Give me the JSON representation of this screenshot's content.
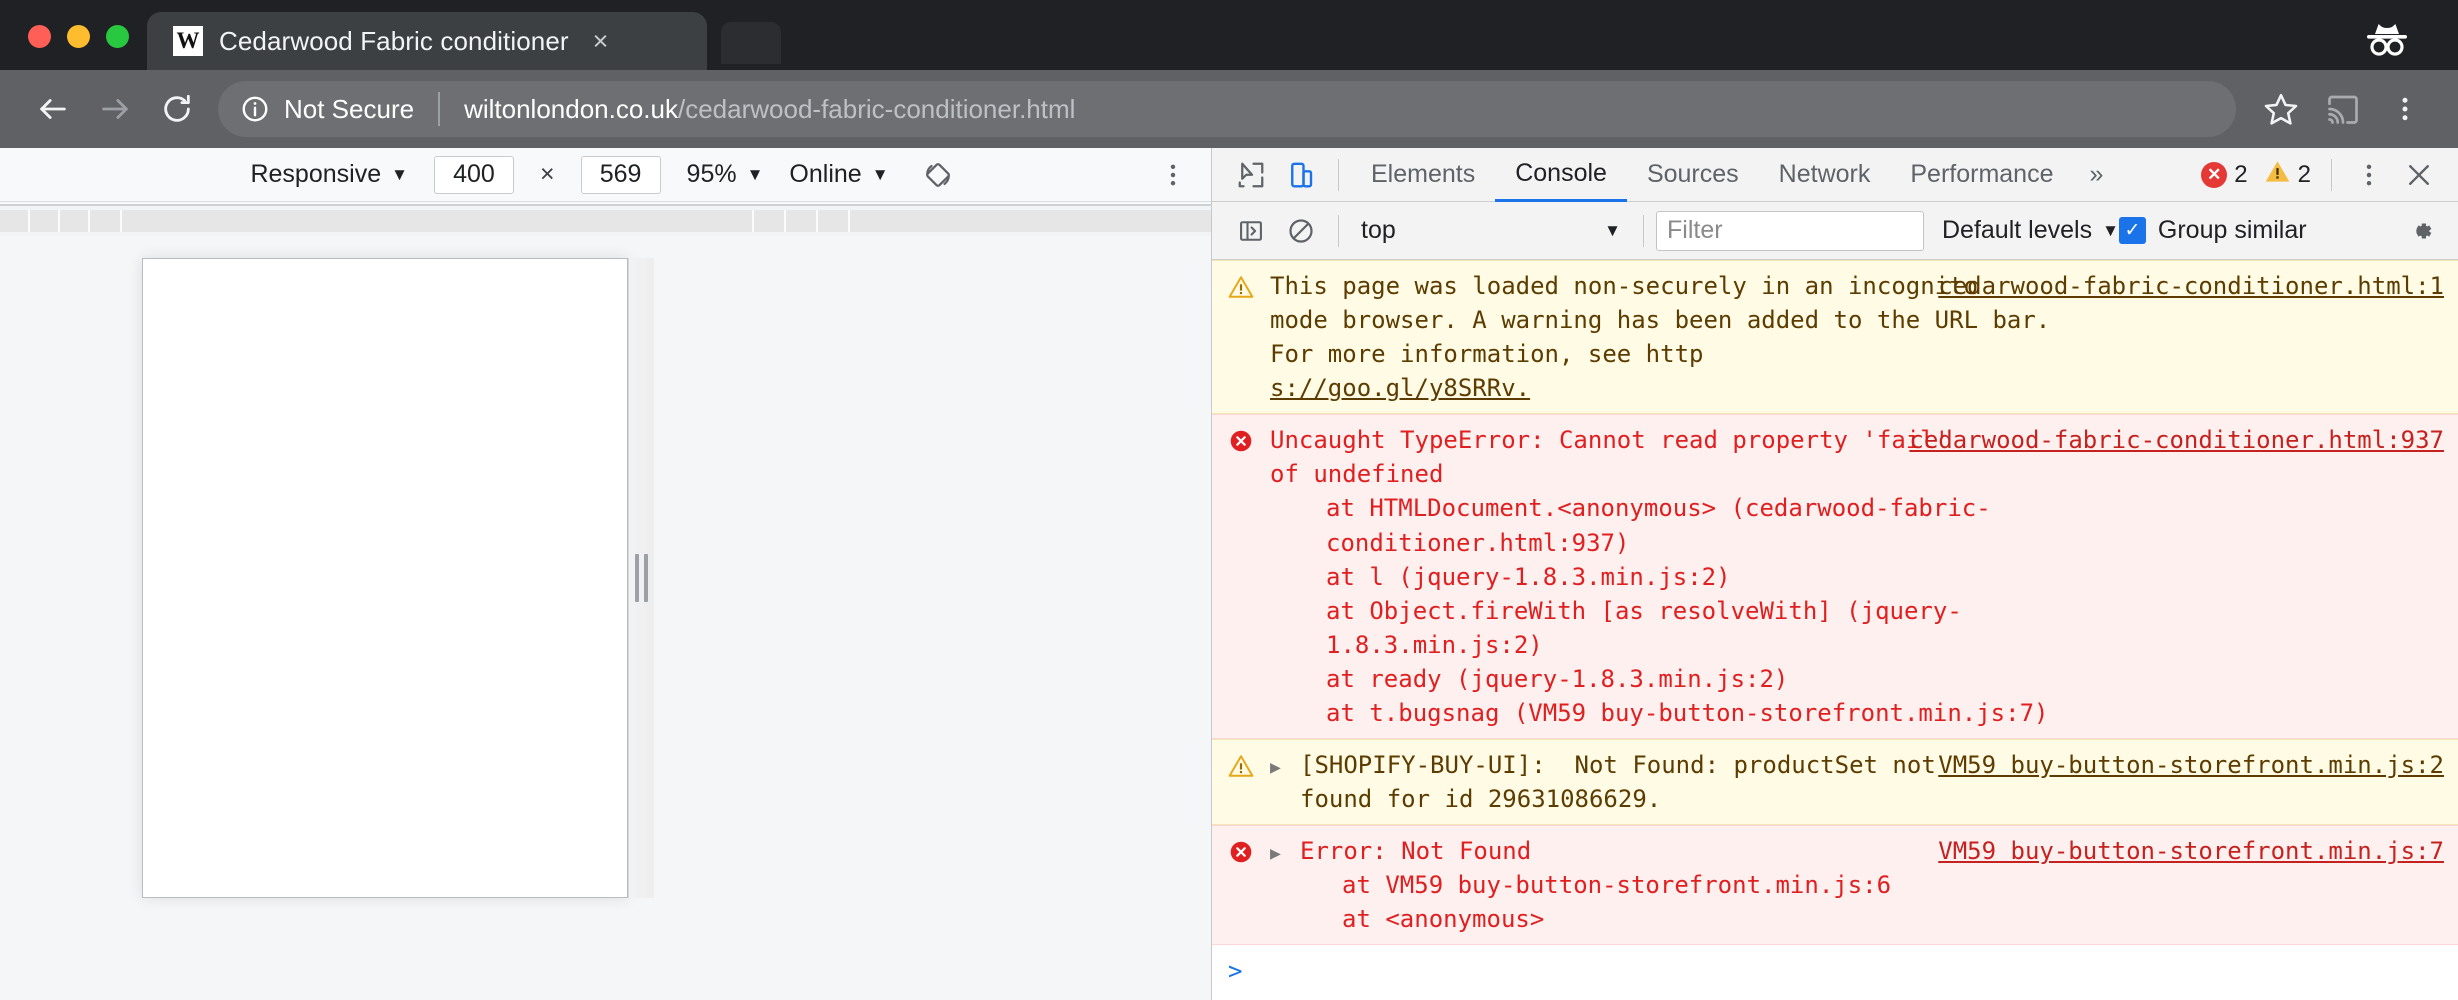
{
  "window": {
    "traffic_lights": [
      "close",
      "minimize",
      "maximize"
    ],
    "incognito_icon": "incognito-icon"
  },
  "tab": {
    "favicon_letter": "W",
    "title": "Cedarwood Fabric conditioner",
    "close_label": "×"
  },
  "toolbar": {
    "back_icon": "back-arrow-icon",
    "forward_icon": "forward-arrow-icon",
    "reload_icon": "reload-icon",
    "info_icon": "info-circle-icon",
    "security_label": "Not Secure",
    "url_host": "wiltonlondon.co.uk",
    "url_path": "/cedarwood-fabric-conditioner.html",
    "star_icon": "star-icon",
    "cast_icon": "cast-icon",
    "menu_icon": "kebab-menu-icon"
  },
  "device_toolbar": {
    "device_label": "Responsive",
    "width": "400",
    "height": "569",
    "times": "×",
    "zoom": "95%",
    "throttle": "Online",
    "rotate_icon": "rotate-device-icon",
    "menu_icon": "kebab-menu-icon"
  },
  "devtools": {
    "inspect_icon": "inspect-element-icon",
    "device_toggle_icon": "device-toolbar-icon",
    "tabs": [
      {
        "label": "Elements",
        "active": false
      },
      {
        "label": "Console",
        "active": true
      },
      {
        "label": "Sources",
        "active": false
      },
      {
        "label": "Network",
        "active": false
      },
      {
        "label": "Performance",
        "active": false
      }
    ],
    "more_tabs": "»",
    "error_count": "2",
    "warning_count": "2",
    "kebab_icon": "kebab-menu-icon",
    "close_icon": "close-devtools-icon",
    "colors": {
      "active_tab_underline": "#1a73e8",
      "error_red": "#e53935",
      "warning_yellow": "#f5bc42",
      "checkbox_blue": "#1a73e8"
    }
  },
  "console_toolbar": {
    "sidebar_icon": "console-sidebar-icon",
    "clear_icon": "clear-console-icon",
    "context": "top",
    "filter_placeholder": "Filter",
    "filter_value": "",
    "levels_label": "Default levels",
    "group_similar_label": "Group similar",
    "group_similar_checked": true,
    "settings_icon": "gear-icon"
  },
  "console_messages": [
    {
      "level": "warning",
      "icon": "warning-triangle-icon",
      "expandable": false,
      "lines": [
        "This page was loaded non-securely in an incognito",
        "mode browser. A warning has been added to the URL bar. For more information, see http",
        "s://goo.gl/y8SRRv."
      ],
      "source": "cedarwood-fabric-conditioner.html:1"
    },
    {
      "level": "error",
      "icon": "error-circle-icon",
      "expandable": false,
      "lines": [
        "Uncaught TypeError: Cannot read property 'fail'",
        "of undefined"
      ],
      "stack": [
        "at HTMLDocument.<anonymous> (cedarwood-fabric-conditioner.html:937)",
        "at l (jquery-1.8.3.min.js:2)",
        "at Object.fireWith [as resolveWith] (jquery-1.8.3.min.js:2)",
        "at ready (jquery-1.8.3.min.js:2)",
        "at t.bugsnag (VM59 buy-button-storefront.min.js:7)"
      ],
      "source": "cedarwood-fabric-conditioner.html:937"
    },
    {
      "level": "warning",
      "icon": "warning-triangle-icon",
      "expandable": true,
      "lines": [
        "[SHOPIFY-BUY-UI]:  Not Found: productSet not",
        "found for id 29631086629."
      ],
      "source": "VM59 buy-button-storefront.min.js:2"
    },
    {
      "level": "error",
      "icon": "error-circle-icon",
      "expandable": true,
      "lines": [
        "Error: Not Found"
      ],
      "stack": [
        "at VM59 buy-button-storefront.min.js:6",
        "at <anonymous>"
      ],
      "source": "VM59 buy-button-storefront.min.js:7"
    }
  ],
  "console_prompt": {
    "caret": ">",
    "value": ""
  },
  "viewport": {
    "page_background": "#ffffff",
    "resize_handle": "viewport-resize-handle"
  }
}
